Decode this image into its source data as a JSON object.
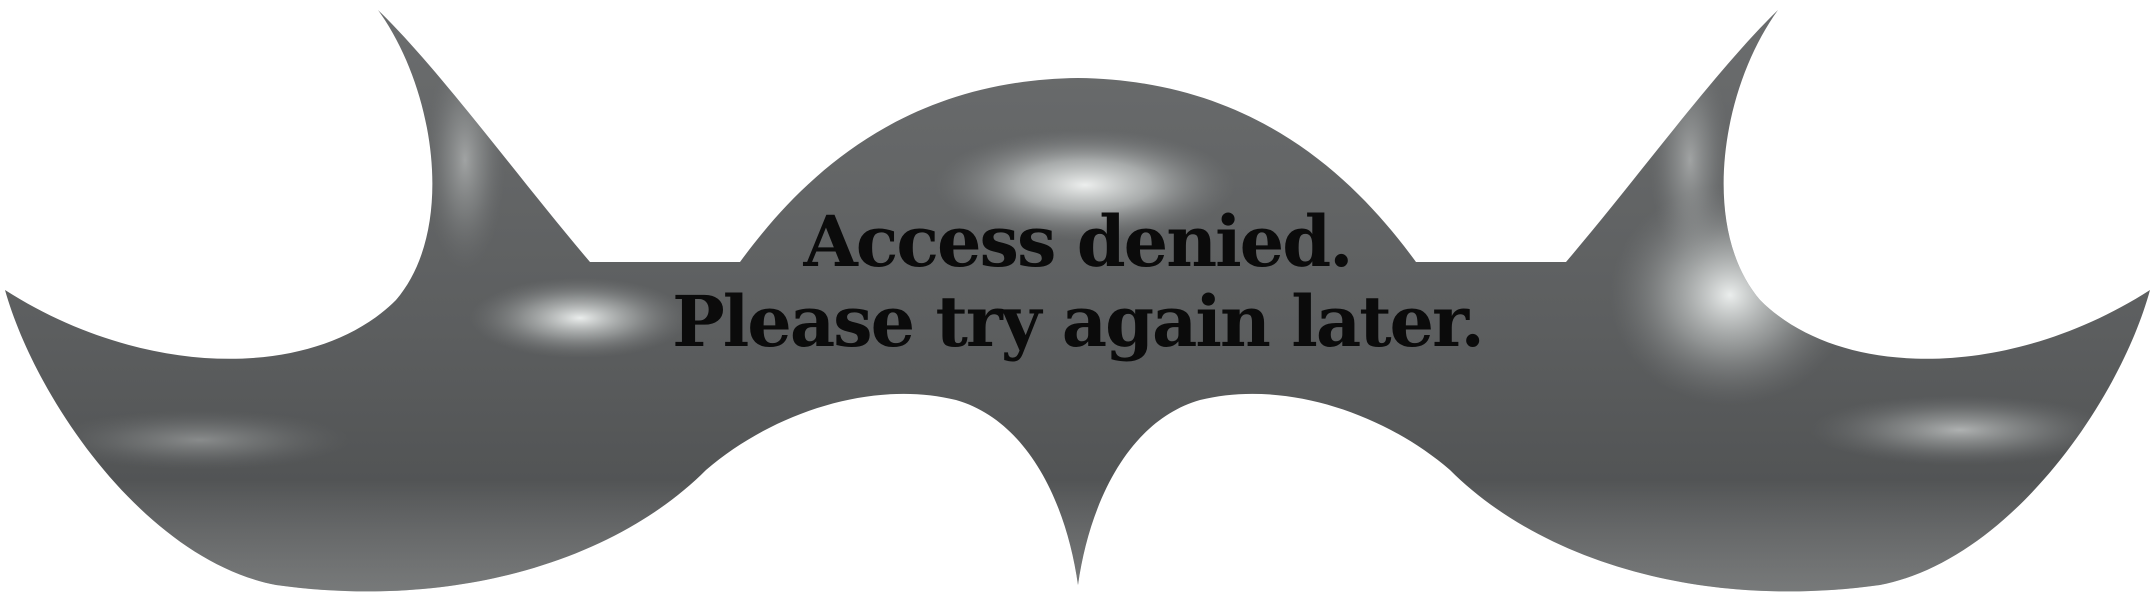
{
  "message": {
    "line1": "Access denied.",
    "line2": "Please try again later."
  },
  "colors": {
    "background": "#ffffff",
    "shape_base": "#5e6061",
    "shape_dark": "#4a4c4d",
    "shape_highlight": "#f2f5f4",
    "text": "#0b0b0b"
  },
  "icons": {
    "decoration": "mustache-icon"
  }
}
